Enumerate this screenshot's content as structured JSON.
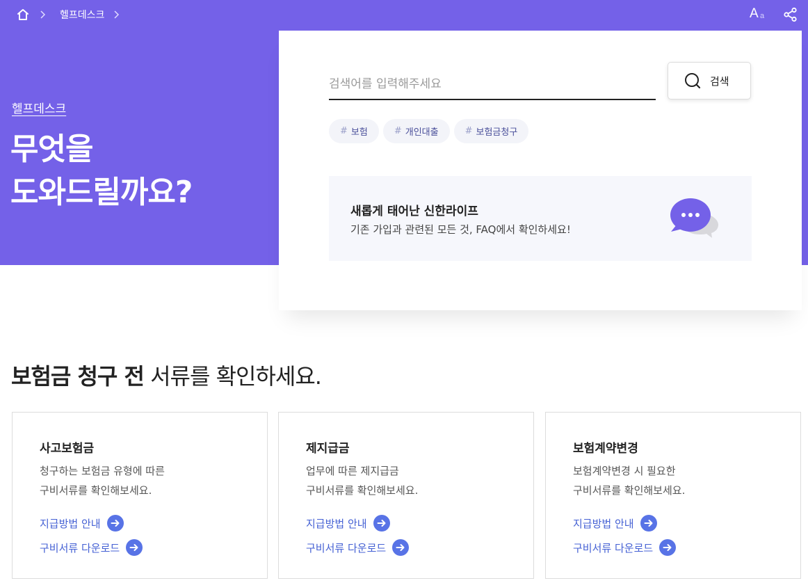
{
  "topbar": {
    "breadcrumb": "헬프데스크",
    "font_size_label_big": "A",
    "font_size_label_small": "a"
  },
  "hero": {
    "label": "헬프데스크",
    "title_line1": "무엇을",
    "title_line2": "도와드릴까요?"
  },
  "search": {
    "placeholder": "검색어를 입력해주세요",
    "value": "",
    "button_label": "검색",
    "tags": [
      {
        "hash": "#",
        "label": "보험"
      },
      {
        "hash": "#",
        "label": "개인대출"
      },
      {
        "hash": "#",
        "label": "보험금청구"
      }
    ]
  },
  "notice": {
    "title": "새롭게 태어난 신한라이프",
    "description": "기존 가입과 관련된 모든 것, FAQ에서 확인하세요!"
  },
  "section": {
    "title_bold": "보험금 청구 전",
    "title_rest": " 서류를 확인하세요."
  },
  "cards": [
    {
      "title": "사고보험금",
      "desc_line1": "청구하는 보험금 유형에 따른",
      "desc_line2": "구비서류를 확인해보세요.",
      "link1": "지급방법 안내",
      "link2": "구비서류 다운로드"
    },
    {
      "title": "제지급금",
      "desc_line1": "업무에 따른 제지급금",
      "desc_line2": "구비서류를 확인해보세요.",
      "link1": "지급방법 안내",
      "link2": "구비서류 다운로드"
    },
    {
      "title": "보험계약변경",
      "desc_line1": "보험계약변경 시 필요한",
      "desc_line2": "구비서류를 확인해보세요.",
      "link1": "지급방법 안내",
      "link2": "구비서류 다운로드"
    }
  ],
  "colors": {
    "hero_bg": "#7461e8",
    "accent": "#4561d4",
    "arrow_circle": "#5873e6",
    "chat_bubble": "#7461e8",
    "tag_bg": "#f3f4f9",
    "notice_bg": "#f6f7fc"
  },
  "icons": [
    "home-icon",
    "chevron-right-icon",
    "font-size-icon",
    "share-icon",
    "search-icon",
    "chat-bubble-icon",
    "arrow-right-circle-icon"
  ]
}
